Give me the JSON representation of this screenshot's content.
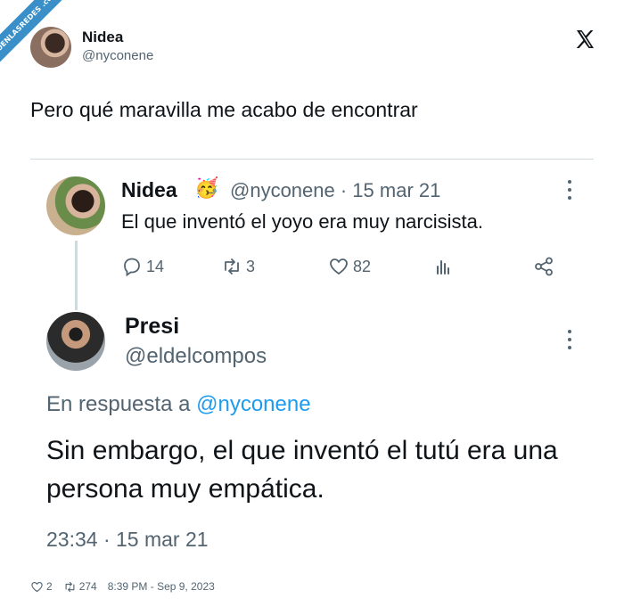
{
  "watermark": {
    "text": "VISTOENLASREDES .com"
  },
  "author": {
    "name": "Nidea",
    "handle": "@nyconene"
  },
  "tweet": {
    "text": "Pero qué maravilla me acabo de encontrar"
  },
  "quoted": {
    "first": {
      "name": "Nidea",
      "emoji": "🥳",
      "meta": "@nyconene · 15 mar 21",
      "text": "El que inventó el yoyo era muy narcisista.",
      "replies": "14",
      "retweets": "3",
      "likes": "82"
    },
    "second": {
      "name": "Presi",
      "handle": "@eldelcompos",
      "reply_prefix": "En respuesta a ",
      "reply_mention": "@nyconene",
      "text": "Sin embargo, el que inventó el tutú era una persona muy empática.",
      "meta": "23:34 · 15 mar 21"
    }
  },
  "footer": {
    "likes": "2",
    "retweets": "274",
    "timestamp": "8:39 PM - Sep 9, 2023"
  },
  "icons": [
    "x-logo-icon",
    "more-icon",
    "reply-icon",
    "retweet-icon",
    "like-icon",
    "views-icon",
    "share-icon"
  ],
  "colors": {
    "text": "#0f1419",
    "muted": "#536471",
    "accent": "#1d9bf0",
    "divider": "#cfd9de",
    "ribbon": "#3a8fc9"
  }
}
